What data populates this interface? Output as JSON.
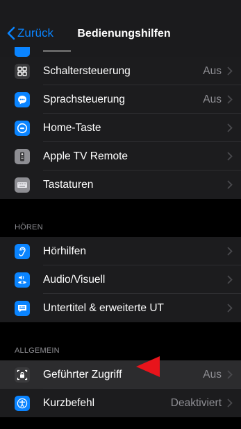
{
  "navbar": {
    "back_label": "Zurück",
    "title": "Bedienungshilfen"
  },
  "group1": [
    {
      "label": "Schaltersteuerung",
      "value": "Aus",
      "icon": "switch-control-icon",
      "color": "#3a3a3c"
    },
    {
      "label": "Sprachsteuerung",
      "value": "Aus",
      "icon": "voice-control-icon",
      "color": "#0a84ff"
    },
    {
      "label": "Home-Taste",
      "value": "",
      "icon": "home-button-icon",
      "color": "#0a84ff"
    },
    {
      "label": "Apple TV Remote",
      "value": "",
      "icon": "tv-remote-icon",
      "color": "#8e8e93"
    },
    {
      "label": "Tastaturen",
      "value": "",
      "icon": "keyboard-icon",
      "color": "#8e8e93"
    }
  ],
  "section_hearing": "HÖREN",
  "group2": [
    {
      "label": "Hörhilfen",
      "value": "",
      "icon": "ear-icon",
      "color": "#0a84ff"
    },
    {
      "label": "Audio/Visuell",
      "value": "",
      "icon": "audio-visual-icon",
      "color": "#0a84ff"
    },
    {
      "label": "Untertitel & erweiterte UT",
      "value": "",
      "icon": "subtitles-icon",
      "color": "#0a84ff"
    }
  ],
  "section_general": "ALLGEMEIN",
  "group3": [
    {
      "label": "Geführter Zugriff",
      "value": "Aus",
      "icon": "guided-access-icon",
      "color": "#3a3a3c"
    },
    {
      "label": "Kurzbefehl",
      "value": "Deaktiviert",
      "icon": "accessibility-icon",
      "color": "#0a84ff"
    }
  ],
  "annotation_color": "#e8141b"
}
